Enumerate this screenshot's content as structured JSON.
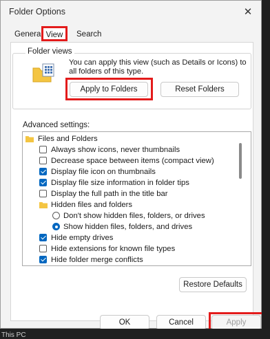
{
  "window": {
    "title": "Folder Options",
    "close_glyph": "✕"
  },
  "background": {
    "label": "This PC"
  },
  "tabs": [
    {
      "label": "General"
    },
    {
      "label": "View"
    },
    {
      "label": "Search"
    }
  ],
  "folder_views": {
    "title": "Folder views",
    "description": "You can apply this view (such as Details or Icons) to all folders of this type.",
    "apply_button": "Apply to Folders",
    "reset_button": "Reset Folders"
  },
  "advanced": {
    "label": "Advanced settings:",
    "items": [
      {
        "label": "Files and Folders",
        "kind": "folder"
      },
      {
        "label": "Always show icons, never thumbnails",
        "kind": "checkbox",
        "checked": false
      },
      {
        "label": "Decrease space between items (compact view)",
        "kind": "checkbox",
        "checked": false
      },
      {
        "label": "Display file icon on thumbnails",
        "kind": "checkbox",
        "checked": true
      },
      {
        "label": "Display file size information in folder tips",
        "kind": "checkbox",
        "checked": true
      },
      {
        "label": "Display the full path in the title bar",
        "kind": "checkbox",
        "checked": false
      },
      {
        "label": "Hidden files and folders",
        "kind": "folder"
      },
      {
        "label": "Don't show hidden files, folders, or drives",
        "kind": "radio",
        "checked": false
      },
      {
        "label": "Show hidden files, folders, and drives",
        "kind": "radio",
        "checked": true
      },
      {
        "label": "Hide empty drives",
        "kind": "checkbox",
        "checked": true
      },
      {
        "label": "Hide extensions for known file types",
        "kind": "checkbox",
        "checked": false
      },
      {
        "label": "Hide folder merge conflicts",
        "kind": "checkbox",
        "checked": true
      }
    ]
  },
  "buttons": {
    "restore": "Restore Defaults",
    "ok": "OK",
    "cancel": "Cancel",
    "apply": "Apply"
  },
  "colors": {
    "highlight": "#e31b1b",
    "check_accent": "#0067c0",
    "folder": "#f4c542"
  }
}
